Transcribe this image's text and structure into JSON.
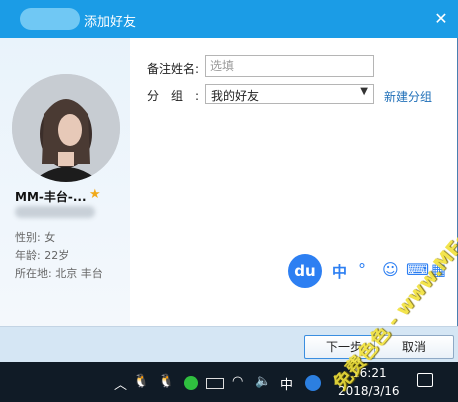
{
  "window": {
    "title": "添加好友",
    "close_glyph": "✕"
  },
  "profile": {
    "nickname": "MM-丰台-...",
    "star_glyph": "★",
    "gender": "性别: 女",
    "age": "年龄: 22岁",
    "location": "所在地: 北京  丰台"
  },
  "form": {
    "remark_label": "备注姓名:",
    "remark_placeholder": "选填",
    "remark_value": "",
    "group_label": "分组:",
    "group_value": "我的好友",
    "group_arrow": "▼",
    "new_group_link": "新建分组"
  },
  "buttons": {
    "next": "下一步",
    "cancel": "取消"
  },
  "ime": {
    "logo": "du",
    "mode": "中",
    "icons": [
      "°",
      "☺",
      "⌨",
      "▦"
    ]
  },
  "watermark": "免费色色 - www.MFsese.com",
  "taskbar": {
    "chevron": "︿",
    "qq1": "🐧",
    "qq2": "🐧",
    "wifi": "◠",
    "volume": "🔈",
    "ime": "中",
    "time": "16:21",
    "date": "2018/3/16"
  },
  "colors": {
    "titlebar": "#1b9ce6",
    "link": "#1f6fb8",
    "ime_blue": "#2d7ff2",
    "watermark": "#f2e23a"
  }
}
